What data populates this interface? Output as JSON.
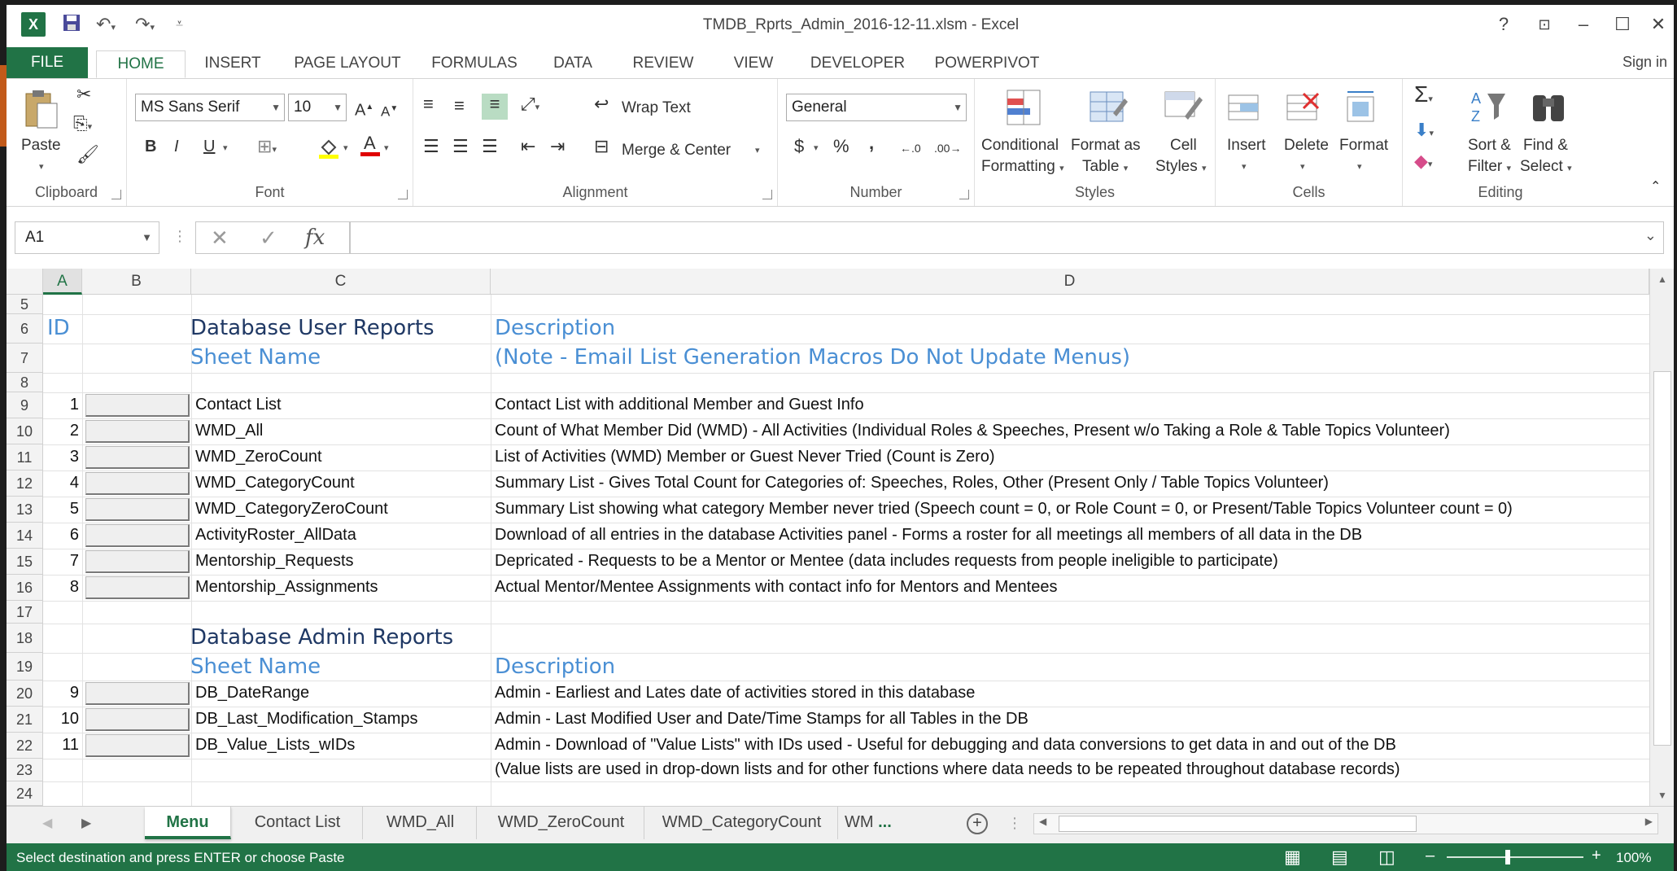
{
  "window": {
    "title": "TMDB_Rprts_Admin_2016-12-11.xlsm - Excel",
    "signin": "Sign in"
  },
  "ribbon_tabs": [
    "FILE",
    "HOME",
    "INSERT",
    "PAGE LAYOUT",
    "FORMULAS",
    "DATA",
    "REVIEW",
    "VIEW",
    "DEVELOPER",
    "POWERPIVOT"
  ],
  "ribbon": {
    "clipboard": {
      "label": "Clipboard",
      "paste": "Paste"
    },
    "font": {
      "label": "Font",
      "name": "MS Sans Serif",
      "size": "10",
      "bold": "B",
      "italic": "I",
      "underline": "U"
    },
    "alignment": {
      "label": "Alignment",
      "wrap_text": "Wrap Text",
      "merge_center": "Merge & Center"
    },
    "number": {
      "label": "Number",
      "format": "General",
      "currency": "$",
      "percent": "%",
      "comma": ","
    },
    "styles": {
      "label": "Styles",
      "cond_format_1": "Conditional",
      "cond_format_2": "Formatting",
      "format_table_1": "Format as",
      "format_table_2": "Table",
      "cell_styles_1": "Cell",
      "cell_styles_2": "Styles"
    },
    "cells": {
      "label": "Cells",
      "insert": "Insert",
      "delete": "Delete",
      "format": "Format"
    },
    "editing": {
      "label": "Editing",
      "sort_1": "Sort &",
      "sort_2": "Filter",
      "find_1": "Find &",
      "find_2": "Select"
    }
  },
  "formula_bar": {
    "name_box": "A1",
    "fx": "fx",
    "value": ""
  },
  "columns": [
    "A",
    "B",
    "C",
    "D"
  ],
  "row_numbers": [
    "5",
    "6",
    "7",
    "8",
    "9",
    "10",
    "11",
    "12",
    "13",
    "14",
    "15",
    "16",
    "17",
    "18",
    "19",
    "20",
    "21",
    "22",
    "23",
    "24"
  ],
  "sheet": {
    "id_header": "ID",
    "user_reports_title": "Database User Reports",
    "description_header": "Description",
    "sheet_name_header": "Sheet Name",
    "note": "(Note - Email List Generation Macros Do Not Update Menus)",
    "user_rows": [
      {
        "id": "1",
        "name": "Contact List",
        "desc": "Contact List with additional Member and Guest Info"
      },
      {
        "id": "2",
        "name": "WMD_All",
        "desc": "Count of What Member Did (WMD) - All Activities (Individual Roles & Speeches, Present w/o Taking a Role & Table Topics Volunteer)"
      },
      {
        "id": "3",
        "name": "WMD_ZeroCount",
        "desc": "List of Activities (WMD) Member or Guest Never Tried (Count is Zero)"
      },
      {
        "id": "4",
        "name": "WMD_CategoryCount",
        "desc": "Summary List - Gives Total Count for Categories of:  Speeches, Roles, Other (Present Only / Table Topics Volunteer)"
      },
      {
        "id": "5",
        "name": "WMD_CategoryZeroCount",
        "desc": "Summary List showing what category Member never tried (Speech count = 0, or Role Count = 0, or Present/Table Topics Volunteer count = 0)"
      },
      {
        "id": "6",
        "name": "ActivityRoster_AllData",
        "desc": "Download of all entries in the database Activities panel - Forms a roster for all meetings all members of all data in the DB"
      },
      {
        "id": "7",
        "name": "Mentorship_Requests",
        "desc": "Depricated - Requests to be a Mentor or Mentee (data includes requests from people ineligible to participate)"
      },
      {
        "id": "8",
        "name": "Mentorship_Assignments",
        "desc": "Actual Mentor/Mentee Assignments with contact info for Mentors and Mentees"
      }
    ],
    "admin_reports_title": "Database Admin Reports",
    "admin_sheet_name_header": "Sheet Name",
    "admin_description_header": "Description",
    "admin_rows": [
      {
        "id": "9",
        "name": "DB_DateRange",
        "desc": "Admin - Earliest and Lates date of activities stored in this database"
      },
      {
        "id": "10",
        "name": "DB_Last_Modification_Stamps",
        "desc": "Admin - Last Modified User and Date/Time Stamps for all Tables in the DB"
      },
      {
        "id": "11",
        "name": "DB_Value_Lists_wIDs",
        "desc": "Admin - Download of \"Value Lists\" with IDs used - Useful for debugging and data conversions to get data in and out of the DB"
      }
    ],
    "admin_note": "(Value lists are used in drop-down lists and for other functions where data needs to be repeated throughout database records)"
  },
  "sheet_tabs": [
    "Menu",
    "Contact List",
    "WMD_All",
    "WMD_ZeroCount",
    "WMD_CategoryCount",
    "WM"
  ],
  "sheet_tabs_more": "...",
  "status": {
    "message": "Select destination and press ENTER or choose Paste",
    "zoom": "100%"
  },
  "colors": {
    "excel_green": "#217346",
    "header_dark": "#1f3864",
    "header_blue": "#4a8fd4"
  }
}
